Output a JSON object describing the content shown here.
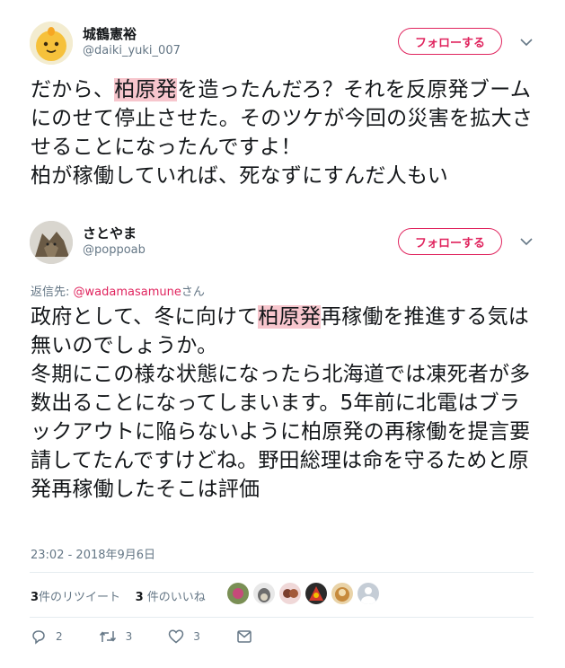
{
  "tweet1": {
    "display_name": "城鶴憲裕",
    "handle": "@daiki_yuki_007",
    "follow_label": "フォローする",
    "text_before": "だから、",
    "text_highlight": "柏原発",
    "text_after": "を造ったんだろ？それを反原発ブームにのせて停止させた。そのツケが今回の災害を拡大させることになったんですよ！\n柏が稼働していれば、死なずにすんだ人もい"
  },
  "tweet2": {
    "display_name": "さとやま",
    "handle": "@poppoab",
    "follow_label": "フォローする",
    "reply_prefix": "返信先: ",
    "reply_mention": "@wadamasamune",
    "reply_suffix": "さん",
    "text_before": "政府として、冬に向けて",
    "text_highlight": "柏原発",
    "text_after": "再稼働を推進する気は無いのでしょうか。\n冬期にこの様な状態になったら北海道では凍死者が多数出ることになってしまいます。5年前に北電はブラックアウトに陥らないように柏原発の再稼働を提言要請してたんですけどね。野田総理は命を守るためと原発再稼働したそこは評価",
    "timestamp": "23:02 - 2018年9月6日",
    "retweet_count": "3",
    "retweet_label": "件のリツイート",
    "like_count": "3",
    "like_label": " 件のいいね",
    "actions": {
      "reply_count": "2",
      "retweet_count": "3",
      "like_count": "3"
    }
  },
  "colors": {
    "accent": "#e0245e",
    "highlight": "#f7c6cd",
    "secondary_text": "#657786",
    "divider": "#e6ecf0"
  },
  "icons": [
    "chevron-down-icon",
    "reply-icon",
    "retweet-icon",
    "heart-icon",
    "direct-message-icon"
  ]
}
